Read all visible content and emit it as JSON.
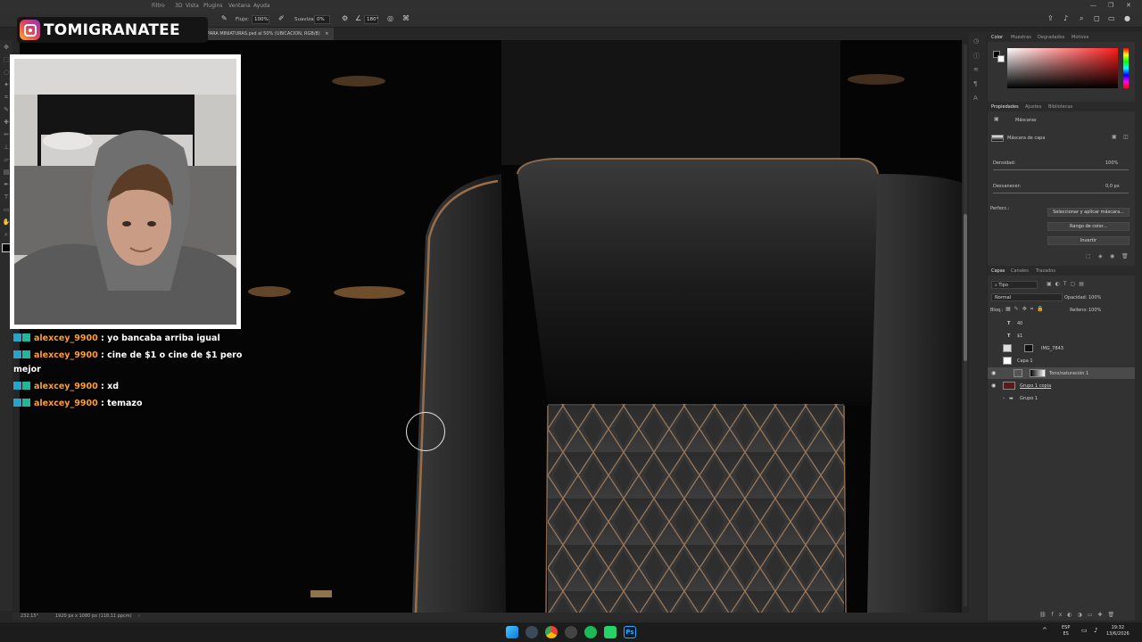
{
  "menubar": {
    "menus": [
      "Filtro",
      "3D",
      "Vista",
      "Plugins",
      "Ventana",
      "Ayuda"
    ],
    "window_controls": [
      "—",
      "❐",
      "✕"
    ]
  },
  "options_bar": {
    "flujo_label": "Flujo:",
    "flujo_value": "100%",
    "suavizar_label": "Suavizar:",
    "suavizar_value": "0%",
    "angle_value": "180°"
  },
  "document_tab": {
    "title": "PARA MINIATURAS.psd al 50% (UBICACION, RGB/8)",
    "close": "×"
  },
  "status_bar": {
    "zoom": "232.15°",
    "doc_size": "1920 px x 1080 px (118,11 ppcm)"
  },
  "color_panel": {
    "tabs": [
      "Color",
      "Muestras",
      "Degradados",
      "Motivos"
    ],
    "foreground": "#000000",
    "background": "#ffffff"
  },
  "properties_panel": {
    "tabs": [
      "Propiedades",
      "Ajustes",
      "Bibliotecas"
    ],
    "section": "Máscaras",
    "mask_type": "Máscara de capa",
    "densidad_label": "Densidad:",
    "densidad_value": "100%",
    "desvanecer_label": "Desvanecer:",
    "desvanecer_value": "0,0 px",
    "perfeccionar_label": "Perfecc.:",
    "buttons": [
      "Seleccionar y aplicar máscara...",
      "Rango de color...",
      "Invertir"
    ]
  },
  "layers_panel": {
    "tabs": [
      "Capas",
      "Canales",
      "Trazados"
    ],
    "filter": "Tipo",
    "blend_mode": "Normal",
    "opacity_label": "Opacidad:",
    "opacity_value": "100%",
    "lock_label": "Bloq.:",
    "fill_label": "Relleno:",
    "fill_value": "100%",
    "layers": [
      {
        "name": "40",
        "kind": "text"
      },
      {
        "name": "$1",
        "kind": "text"
      },
      {
        "name": "IMG_7843",
        "kind": "image"
      },
      {
        "name": "Capa 1",
        "kind": "layer"
      },
      {
        "name": "Tono/saturación 1",
        "kind": "adjustment"
      },
      {
        "name": "Grupo 1 copia",
        "kind": "group"
      },
      {
        "name": "Grupo 1",
        "kind": "group"
      }
    ]
  },
  "overlay": {
    "handle": "TOMIGRANATEE",
    "chat": [
      {
        "user": "alexcey_9900",
        "text": "yo bancaba arriba igual"
      },
      {
        "user": "alexcey_9900",
        "text": "cine de $1 o cine de $1 pero mejor"
      },
      {
        "user": "alexcey_9900",
        "text": "xd"
      },
      {
        "user": "alexcey_9900",
        "text": "temazo"
      }
    ]
  },
  "taskbar": {
    "lang_top": "ESP",
    "lang_bottom": "ES",
    "time": "19:32",
    "date": "13/6/2026"
  }
}
